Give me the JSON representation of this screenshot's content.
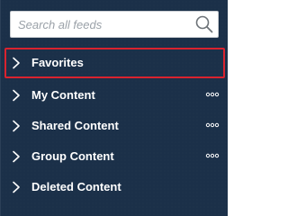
{
  "search": {
    "placeholder": "Search all feeds",
    "value": ""
  },
  "nav": {
    "items": [
      {
        "label": "Favorites",
        "selected": true,
        "has_more": false
      },
      {
        "label": "My Content",
        "selected": false,
        "has_more": true
      },
      {
        "label": "Shared Content",
        "selected": false,
        "has_more": true
      },
      {
        "label": "Group Content",
        "selected": false,
        "has_more": true
      },
      {
        "label": "Deleted Content",
        "selected": false,
        "has_more": false
      }
    ]
  },
  "icons": {
    "search": "search-icon",
    "chevron": "chevron-right-icon",
    "more": "more-options-icon"
  },
  "colors": {
    "panel_background": "#1b3049",
    "selection_border": "#d9232e",
    "text": "#ffffff"
  }
}
